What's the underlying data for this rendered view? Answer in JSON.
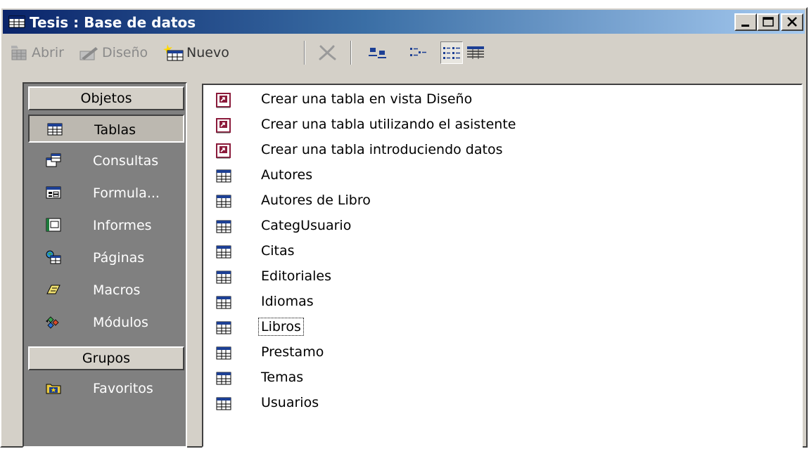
{
  "window": {
    "title": "Tesis : Base de datos",
    "icon": "database-window-icon"
  },
  "toolbar": {
    "open_label": "Abrir",
    "design_label": "Diseño",
    "new_label": "Nuevo",
    "delete_icon": "delete-x-icon",
    "views": [
      "large-icons-view",
      "small-icons-view",
      "list-view",
      "details-view"
    ],
    "active_view": "list-view"
  },
  "objects_bar": {
    "objects_header": "Objetos",
    "groups_header": "Grupos",
    "items": [
      {
        "label": "Tablas",
        "icon": "table-icon",
        "selected": true
      },
      {
        "label": "Consultas",
        "icon": "query-icon",
        "selected": false
      },
      {
        "label": "Formula...",
        "icon": "form-icon",
        "selected": false
      },
      {
        "label": "Informes",
        "icon": "report-icon",
        "selected": false
      },
      {
        "label": "Páginas",
        "icon": "page-icon",
        "selected": false
      },
      {
        "label": "Macros",
        "icon": "macro-icon",
        "selected": false
      },
      {
        "label": "Módulos",
        "icon": "module-icon",
        "selected": false
      }
    ],
    "groups": [
      {
        "label": "Favoritos",
        "icon": "favorites-folder-icon"
      }
    ]
  },
  "list": {
    "shortcuts": [
      {
        "label": "Crear una tabla en vista Diseño",
        "icon": "shortcut-icon"
      },
      {
        "label": "Crear una tabla utilizando el asistente",
        "icon": "shortcut-icon"
      },
      {
        "label": "Crear una tabla introduciendo datos",
        "icon": "shortcut-icon"
      }
    ],
    "tables": [
      "Autores",
      "Autores de Libro",
      "CategUsuario",
      "Citas",
      "Editoriales",
      "Idiomas",
      "Libros",
      "Prestamo",
      "Temas",
      "Usuarios"
    ],
    "focused_item": "Libros"
  },
  "colors": {
    "titlebar_start": "#0a246a",
    "titlebar_end": "#a6caf0",
    "face": "#d4d0c8",
    "objects_bar": "#808080",
    "shortcut_icon": "#8b1a3a"
  }
}
